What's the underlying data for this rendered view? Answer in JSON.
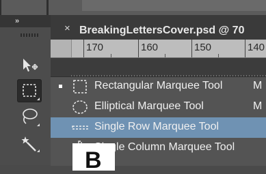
{
  "tools_panel": {
    "collapse_glyph": "»",
    "tools": [
      {
        "icon": "move-icon"
      },
      {
        "icon": "rectangular-marquee-icon",
        "selected": true
      },
      {
        "icon": "lasso-icon"
      },
      {
        "icon": "magic-wand-icon"
      }
    ]
  },
  "document": {
    "close_glyph": "×",
    "title": "BreakingLettersCover.psd @ 70"
  },
  "ruler": {
    "labels": [
      "170",
      "160",
      "150",
      "140"
    ]
  },
  "flyout_menu": {
    "items": [
      {
        "label": "Rectangular Marquee Tool",
        "shortcut": "M",
        "checked": true,
        "icon": "rectangular-marquee-icon"
      },
      {
        "label": "Elliptical Marquee Tool",
        "shortcut": "M",
        "checked": false,
        "icon": "elliptical-marquee-icon"
      },
      {
        "label": "Single Row Marquee Tool",
        "shortcut": "",
        "checked": false,
        "highlighted": true,
        "icon": "single-row-marquee-icon"
      },
      {
        "label": "Single Column Marquee Tool",
        "shortcut": "",
        "checked": false,
        "icon": "single-column-marquee-icon"
      }
    ]
  },
  "overlay_letter": "B",
  "colors": {
    "highlight": "#6f92b3",
    "menu_bg": "#545454",
    "ruler_bg": "#bdbdbd"
  }
}
